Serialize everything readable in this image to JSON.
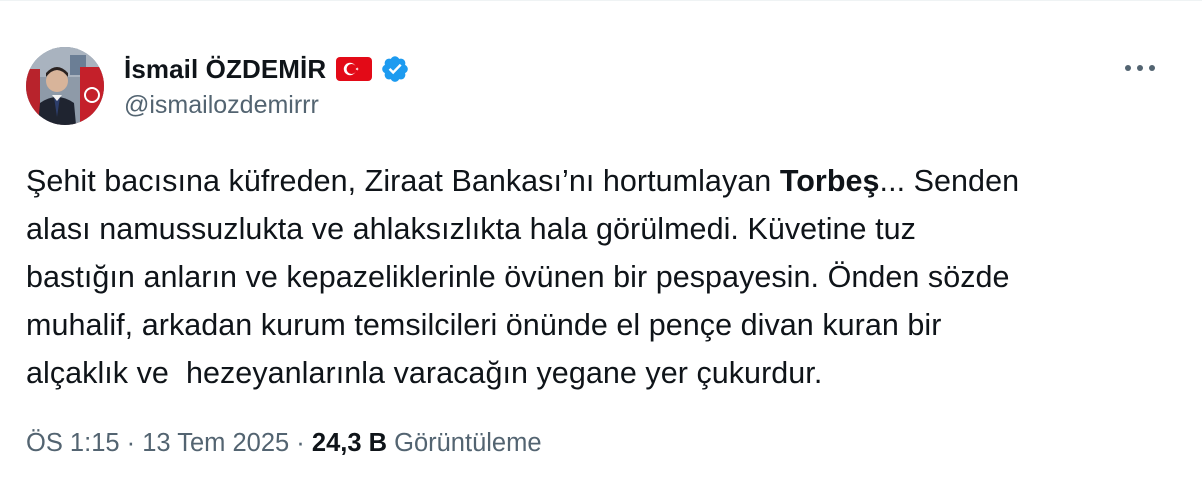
{
  "author": {
    "display_name": "İsmail ÖZDEMİR",
    "handle": "@ismailozdemirrr",
    "flag_icon": "turkey-flag-icon",
    "verified_icon": "verified-badge-icon",
    "verified_color": "#1d9bf0",
    "flag_color": "#e30a17"
  },
  "more_icon": "more-horizontal-icon",
  "tweet": {
    "line1_pre": "Şehit bacısına küfreden, Ziraat Bankası’nı hortumlayan ",
    "line1_bold": "Torbeş",
    "line1_post": "... Senden",
    "line2": "alası namussuzlukta ve ahlaksızlıkta hala görülmedi. Küvetine tuz",
    "line3": "bastığın anların ve kepazeliklerinle övünen bir pespayesin. Önden sözde",
    "line4": "muhalif, arkadan kurum temsilcileri önünde el pençe divan kuran bir",
    "line5": "alçaklık ve  hezeyanlarınla varacağın yegane yer çukurdur."
  },
  "meta": {
    "time": "ÖS 1:15",
    "separator1": " · ",
    "date": "13 Tem 2025",
    "separator2": " · ",
    "views_count": "24,3 B",
    "views_label": " Görüntüleme"
  },
  "colors": {
    "text_primary": "#0f1419",
    "text_secondary": "#536471"
  }
}
